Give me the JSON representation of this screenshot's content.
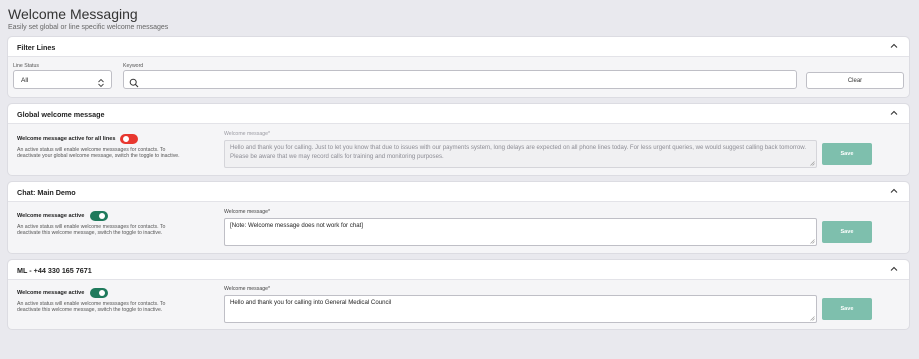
{
  "page": {
    "title": "Welcome Messaging",
    "subtitle": "Easily set global or line specific welcome messages"
  },
  "filter": {
    "title": "Filter Lines",
    "line_status_label": "Line Status",
    "line_status_value": "All",
    "keyword_label": "Keyword",
    "keyword_value": "",
    "clear_label": "Clear"
  },
  "global": {
    "title": "Global welcome message",
    "toggle_label": "Welcome message active for all lines",
    "toggle_state": "off",
    "help": "An active status will enable welcome messsages for contacts. To deactivate your global welcome message, switch the toggle to inactive.",
    "message_label": "Welcome message*",
    "message": "Hello and thank you for calling. Just to let you know that due to issues with our payments system, long delays are expected on all phone lines today. For less urgent queries, we would suggest calling back tomorrow. Please be aware that we may record calls for training and monitoring purposes.",
    "save_label": "Save"
  },
  "chat": {
    "title": "Chat: Main Demo",
    "toggle_label": "Welcome message active",
    "toggle_state": "on",
    "help": "An active status will enable welcome messsages for contacts. To deactivate this welcome message, switch the toggle to inactive.",
    "message_label": "Welcome message*",
    "message": "[Note: Welcome message does not work for chat]",
    "save_label": "Save"
  },
  "ml": {
    "title": "ML - +44 330 165 7671",
    "toggle_label": "Welcome message active",
    "toggle_state": "on",
    "help": "An active status will enable welcome messsages for contacts. To deactivate this welcome message, switch the toggle to inactive.",
    "message_label": "Welcome message*",
    "message": "Hello and thank you for calling into General Medical Council",
    "save_label": "Save"
  },
  "colors": {
    "toggle_off": "#e8372f",
    "toggle_on": "#1f7a5c",
    "save_button": "#7ebfad"
  }
}
